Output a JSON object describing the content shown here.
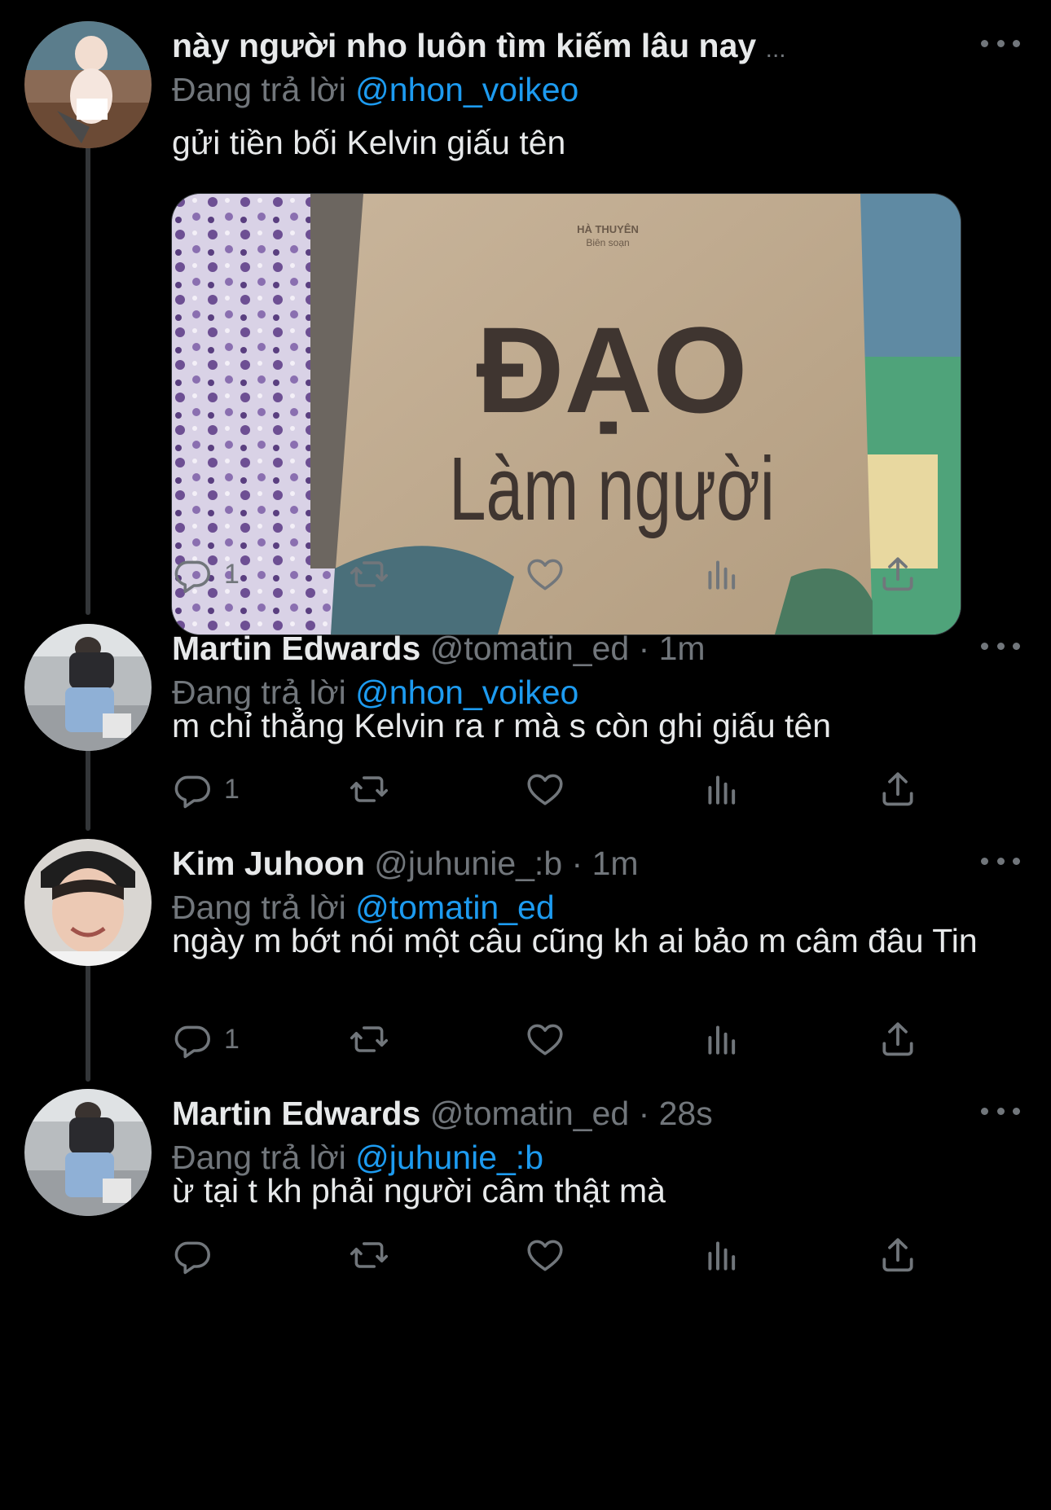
{
  "colors": {
    "background": "#000000",
    "text": "#e7e9ea",
    "secondary": "#71767b",
    "accent": "#1d9bf0",
    "thread_line": "#333639"
  },
  "icons": {
    "reply": "reply-icon",
    "retweet": "retweet-icon",
    "like": "heart-icon",
    "views": "views-icon",
    "share": "share-icon",
    "more": "more-icon"
  },
  "tweets": [
    {
      "display_name": "này người nho luôn tìm kiếm lâu nay",
      "truncation": "...",
      "handle": "",
      "time": "",
      "replying_prefix": "Đang trả lời",
      "replying_to": "@nhon_voikeo",
      "text": "gửi tiền bối Kelvin giấu tên",
      "reply_count": "1",
      "media": {
        "author_line": "HÀ THUYÊN",
        "editor_line": "Biên soạn",
        "title_top": "ĐẠO",
        "title_bottom": "Làm người"
      }
    },
    {
      "display_name": "Martin Edwards",
      "handle": "@tomatin_ed",
      "time": "· 1m",
      "replying_prefix": "Đang trả lời",
      "replying_to": "@nhon_voikeo",
      "text": "m chỉ thẳng Kelvin ra r mà s còn ghi giấu tên",
      "reply_count": "1"
    },
    {
      "display_name": "Kim Juhoon",
      "handle": "@juhunie_:b",
      "time": "· 1m",
      "replying_prefix": "Đang trả lời",
      "replying_to": "@tomatin_ed",
      "text": "ngày m bớt nói một câu cũng kh ai bảo m câm đâu Tin",
      "reply_count": "1"
    },
    {
      "display_name": "Martin Edwards",
      "handle": "@tomatin_ed",
      "time": "· 28s",
      "replying_prefix": "Đang trả lời",
      "replying_to": "@juhunie_:b",
      "text": "ừ tại t kh phải người câm thật mà",
      "reply_count": ""
    }
  ]
}
